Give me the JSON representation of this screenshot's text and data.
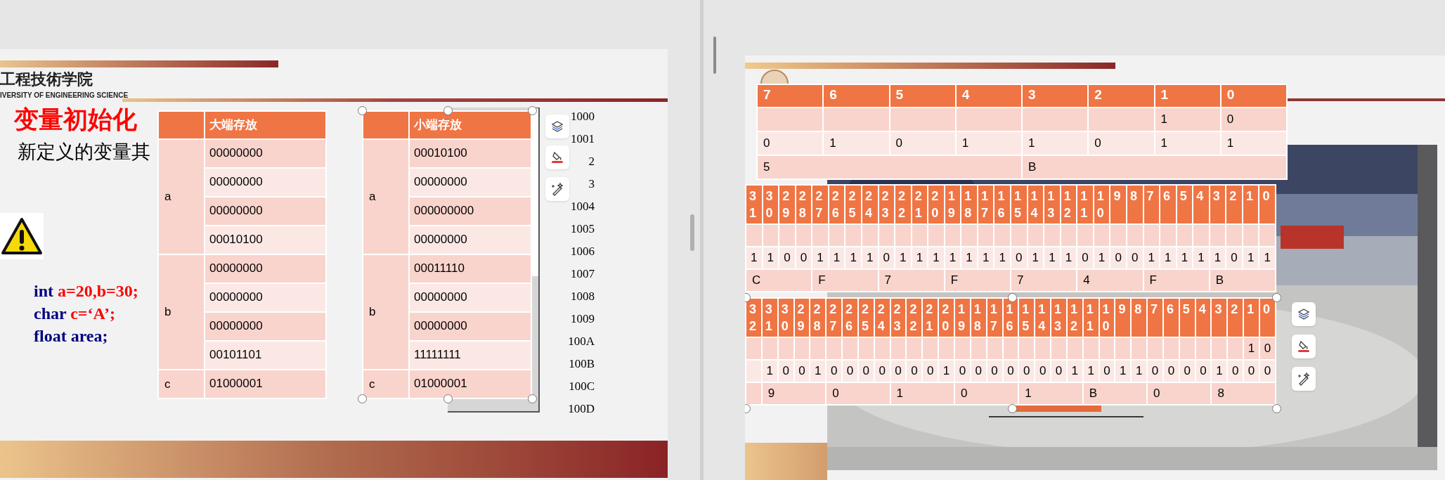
{
  "left_slide": {
    "logo": {
      "name": "工程技術学院",
      "name_en": "IVERSITY OF ENGINEERING SCIENCE"
    },
    "title": "变量初始化",
    "subtitle": "新定义的变量其",
    "code_lines": [
      {
        "segments": [
          {
            "kind": "keyword",
            "text": "int"
          },
          {
            "kind": "value",
            "text": "a=20,b=30;"
          }
        ]
      },
      {
        "segments": [
          {
            "kind": "keyword",
            "text": "char"
          },
          {
            "kind": "value",
            "text": "c=‘A’;"
          }
        ]
      },
      {
        "segments": [
          {
            "kind": "keyword",
            "text": "float area;"
          }
        ]
      }
    ],
    "endian_tables": [
      {
        "title": "大端存放",
        "groups": [
          {
            "label": "a",
            "values": [
              "00000000",
              "00000000",
              "00000000",
              "00010100"
            ]
          },
          {
            "label": "b",
            "values": [
              "00000000",
              "00000000",
              "00000000",
              "00101101"
            ]
          },
          {
            "label": "c",
            "values": [
              "01000001"
            ]
          }
        ]
      },
      {
        "title": "小端存放",
        "groups": [
          {
            "label": "a",
            "values": [
              "00010100",
              "00000000",
              "000000000",
              "00000000"
            ]
          },
          {
            "label": "b",
            "values": [
              "00011110",
              "00000000",
              "00000000",
              "11111111"
            ]
          },
          {
            "label": "c",
            "values": [
              "01000001"
            ]
          }
        ]
      }
    ],
    "addresses": [
      "1000",
      "1001",
      "2",
      "3",
      "1004",
      "1005",
      "1006",
      "1007",
      "1008",
      "1009",
      "100A",
      "100B",
      "100C",
      "100D"
    ]
  },
  "right_slide": {
    "bit_tables": [
      {
        "headers": [
          "7",
          "6",
          "5",
          "4",
          "3",
          "2",
          "1",
          "0"
        ],
        "rows": [
          {
            "kind": "bits",
            "values": [
              "1",
              "0"
            ]
          },
          {
            "kind": "bits",
            "values": [
              "0",
              "1",
              "0",
              "1",
              "1",
              "0",
              "1",
              "1"
            ]
          },
          {
            "kind": "hex",
            "values": [
              "5",
              "B"
            ]
          }
        ]
      },
      {
        "headers": [
          "31",
          "30",
          "29",
          "28",
          "27",
          "26",
          "25",
          "24",
          "23",
          "22",
          "21",
          "20",
          "19",
          "18",
          "17",
          "16",
          "15",
          "14",
          "13",
          "12",
          "11",
          "10",
          "9",
          "8",
          "7",
          "6",
          "5",
          "4",
          "3",
          "2",
          "1",
          "0"
        ],
        "rows": [
          {
            "kind": "bits"
          },
          {
            "kind": "bits",
            "values": [
              "1",
              "1",
              "0",
              "0",
              "1",
              "1",
              "1",
              "1",
              "0",
              "1",
              "1",
              "1",
              "1",
              "1",
              "1",
              "1",
              "0",
              "1",
              "1",
              "1",
              "0",
              "1",
              "0",
              "0",
              "1",
              "1",
              "1",
              "1",
              "1",
              "0",
              "1",
              "1"
            ]
          },
          {
            "kind": "hex",
            "values": [
              "C",
              "F",
              "7",
              "F",
              "7",
              "4",
              "F",
              "B"
            ]
          }
        ]
      },
      {
        "headers": [
          "32",
          "31",
          "30",
          "29",
          "28",
          "27",
          "26",
          "25",
          "24",
          "23",
          "22",
          "21",
          "20",
          "19",
          "18",
          "17",
          "16",
          "15",
          "14",
          "13",
          "12",
          "11",
          "10",
          "9",
          "8",
          "7",
          "6",
          "5",
          "4",
          "3",
          "2",
          "1",
          "0"
        ],
        "rows": [
          {
            "kind": "bits",
            "values": [
              "1",
              "0"
            ]
          },
          {
            "kind": "bits",
            "values": [
              "1",
              "0",
              "0",
              "1",
              "0",
              "0",
              "0",
              "0",
              "0",
              "0",
              "0",
              "1",
              "0",
              "0",
              "0",
              "0",
              "0",
              "0",
              "0",
              "1",
              "1",
              "0",
              "1",
              "1",
              "0",
              "0",
              "0",
              "0",
              "1",
              "0",
              "0",
              "0"
            ]
          },
          {
            "kind": "hex",
            "values": [
              "9",
              "0",
              "1",
              "0",
              "1",
              "B",
              "0",
              "8"
            ]
          }
        ]
      }
    ]
  }
}
